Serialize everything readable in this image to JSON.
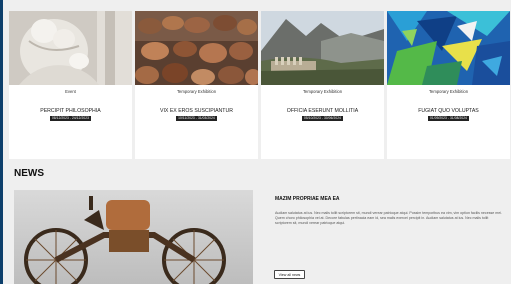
{
  "events": [
    {
      "category": "Event",
      "title": "PERCIPIT PHILOSOPHIA",
      "dates": "08/12/2023 - 24/12/2023",
      "image": "marble-sculpture-image"
    },
    {
      "category": "Temporary Exhibition",
      "title": "VIX EX EROS SUSCIPIANTUR",
      "dates": "10/11/2023 - 31/03/2024",
      "image": "pottery-image"
    },
    {
      "category": "Temporary Exhibition",
      "title": "OFFICIA ESERUNT MOLLITIA",
      "dates": "05/10/2023 - 30/06/2024",
      "image": "mountain-ruins-image"
    },
    {
      "category": "Temporary Exhibition",
      "title": "FUGIAT QUO VOLUPTAS",
      "dates": "01/09/2023 - 31/08/2024",
      "image": "abstract-painting-image"
    }
  ],
  "news": {
    "heading": "NEWS",
    "image": "antique-motorcycle-image",
    "item_title": "MAZIM PROPRIAE MEA EA",
    "item_text": "Audiam salutatus at ius. Nec malis tollit scriptorem sit, mundi verear patrioque atqui. Possim temporibus ea vim, vim option facilis necesse mei. Quem choro philosophia vel at. Decore fabulas pertinacia eam id, sea malis exercei percipit in. Audiam salutatus at ius. Nec malis tollit scriptorem sit, mundi verear patrioque atqui.",
    "button_label": "View all news"
  }
}
